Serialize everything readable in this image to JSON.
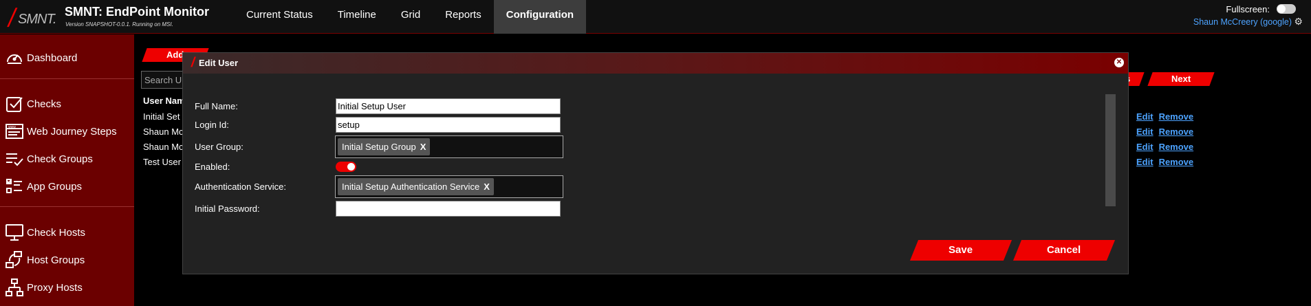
{
  "app": {
    "logo_text": "SMNT.",
    "title": "SMNT: EndPoint Monitor",
    "version": "Version SNAPSHOT-0.0.1. Running on MSI."
  },
  "nav": {
    "tabs": [
      {
        "label": "Current Status"
      },
      {
        "label": "Timeline"
      },
      {
        "label": "Grid"
      },
      {
        "label": "Reports"
      },
      {
        "label": "Configuration",
        "active": true
      }
    ]
  },
  "header_right": {
    "fullscreen_label": "Fullscreen:",
    "fullscreen_on": false,
    "user_name": "Shaun McCreery (google)"
  },
  "sidebar": {
    "items": [
      {
        "label": "Dashboard",
        "icon": "dashboard-icon"
      },
      {
        "label": "Checks",
        "icon": "checkbox-icon"
      },
      {
        "label": "Web Journey Steps",
        "icon": "browser-icon"
      },
      {
        "label": "Check Groups",
        "icon": "list-check-icon"
      },
      {
        "label": "App Groups",
        "icon": "app-list-icon"
      },
      {
        "label": "Check Hosts",
        "icon": "monitor-icon"
      },
      {
        "label": "Host Groups",
        "icon": "host-groups-icon"
      },
      {
        "label": "Proxy Hosts",
        "icon": "network-icon"
      }
    ]
  },
  "background": {
    "add_label": "Add",
    "search_placeholder": "Search U",
    "prev_label": "s",
    "next_label": "Next",
    "column_header": "User Nam",
    "rows": [
      {
        "name": "Initial Set"
      },
      {
        "name": "Shaun Mc"
      },
      {
        "name": "Shaun Mc"
      },
      {
        "name": "Test User"
      }
    ],
    "edit_label": "Edit",
    "remove_label": "Remove"
  },
  "modal": {
    "title": "Edit User",
    "fields": {
      "full_name_label": "Full Name:",
      "full_name_value": "Initial Setup User",
      "login_id_label": "Login Id:",
      "login_id_value": "setup",
      "user_group_label": "User Group:",
      "user_group_tag": "Initial Setup Group",
      "enabled_label": "Enabled:",
      "enabled": true,
      "auth_service_label": "Authentication Service:",
      "auth_service_tag": "Initial Setup Authentication Service",
      "password_label": "Initial Password:",
      "password_value": ""
    },
    "tag_remove": "X",
    "save_label": "Save",
    "cancel_label": "Cancel"
  },
  "colors": {
    "accent": "#ee0000",
    "sidebar_bg": "#6b0000",
    "link": "#4da3ff"
  }
}
